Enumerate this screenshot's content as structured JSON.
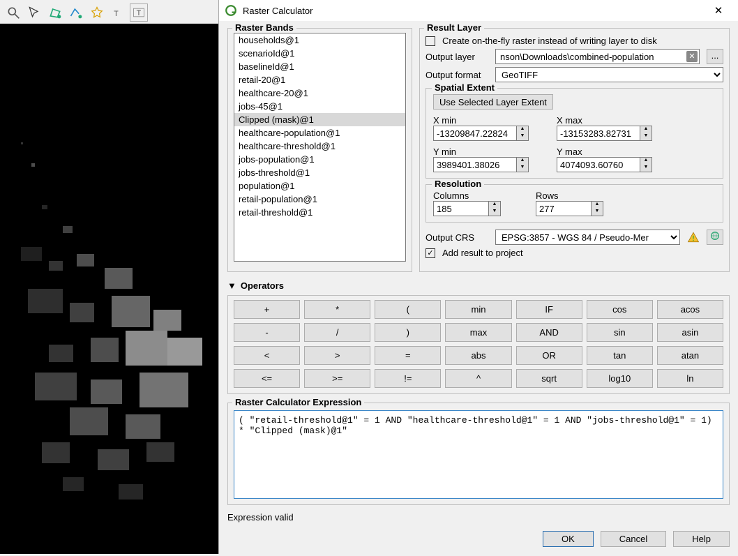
{
  "dialog": {
    "title": "Raster Calculator",
    "bands_legend": "Raster Bands",
    "bands": [
      "households@1",
      "scenarioId@1",
      "baselineId@1",
      "retail-20@1",
      "healthcare-20@1",
      "jobs-45@1",
      "Clipped (mask)@1",
      "healthcare-population@1",
      "healthcare-threshold@1",
      "jobs-population@1",
      "jobs-threshold@1",
      "population@1",
      "retail-population@1",
      "retail-threshold@1"
    ],
    "selected_band_index": 6,
    "result": {
      "legend": "Result Layer",
      "onfly_label": "Create on-the-fly raster instead of writing layer to disk",
      "onfly_checked": false,
      "output_layer_label": "Output layer",
      "output_layer_value": "nson\\Downloads\\combined-population",
      "browse_label": "...",
      "output_format_label": "Output format",
      "output_format_value": "GeoTIFF",
      "spatial_legend": "Spatial Extent",
      "use_selected_btn": "Use Selected Layer Extent",
      "xmin_label": "X min",
      "xmin": "-13209847.22824",
      "xmax_label": "X max",
      "xmax": "-13153283.82731",
      "ymin_label": "Y min",
      "ymin": "3989401.38026",
      "ymax_label": "Y max",
      "ymax": "4074093.60760",
      "resolution_legend": "Resolution",
      "columns_label": "Columns",
      "columns": "185",
      "rows_label": "Rows",
      "rows": "277",
      "crs_label": "Output CRS",
      "crs_value": "EPSG:3857 - WGS 84 / Pseudo-Mer",
      "add_to_project_label": "Add result to project",
      "add_to_project_checked": true
    },
    "operators_legend": "Operators",
    "operators": [
      "+",
      "*",
      "(",
      "min",
      "IF",
      "cos",
      "acos",
      "-",
      "/",
      ")",
      "max",
      "AND",
      "sin",
      "asin",
      "<",
      ">",
      "=",
      "abs",
      "OR",
      "tan",
      "atan",
      "<=",
      ">=",
      "!=",
      "^",
      "sqrt",
      "log10",
      "ln"
    ],
    "expression_legend": "Raster Calculator Expression",
    "expression": "( \"retail-threshold@1\" = 1 AND \"healthcare-threshold@1\" = 1 AND \"jobs-threshold@1\" = 1) * \"Clipped (mask)@1\"",
    "expression_status": "Expression valid",
    "buttons": {
      "ok": "OK",
      "cancel": "Cancel",
      "help": "Help"
    }
  }
}
